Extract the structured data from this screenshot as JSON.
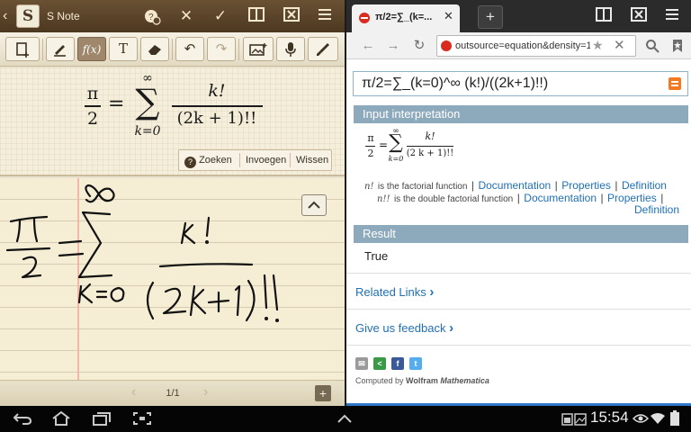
{
  "snote": {
    "app_title": "S Note",
    "icons": {
      "back": "back-arrow-icon",
      "logo": "s-note-logo-icon",
      "top_bar": [
        "recognize-math-icon",
        "close-icon",
        "checkmark-icon",
        "split-view-icon",
        "delete-page-icon",
        "menu-icon"
      ],
      "toolbar": [
        "insert-page-icon",
        "pen-icon",
        "formula-match-icon",
        "text-mode-icon",
        "eraser-icon",
        "undo-icon",
        "redo-icon",
        "insert-image-icon",
        "voice-icon",
        "brush-icon"
      ]
    },
    "formula": {
      "lhs_num": "π",
      "lhs_den": "2",
      "equals": "=",
      "sum_upper": "∞",
      "sum_sign": "∑",
      "sum_lower": "k=0",
      "frac_num": "k!",
      "frac_den": "(2k + 1)!!"
    },
    "convert_buttons": {
      "search": "Zoeken",
      "insert": "Invoegen",
      "clear": "Wissen"
    },
    "handwriting": {
      "text": "π/2 = ∑ k!/(2k+1)!!"
    },
    "pager": {
      "page": "1/1"
    }
  },
  "browser": {
    "tab_title": "π/2=∑_(k=...",
    "tab_close": "✕",
    "new_tab": "+",
    "url": "outsource=equation&density=1",
    "icons": {
      "tab_favicon": "wolfram-favicon-icon",
      "back": "back-icon",
      "forward": "forward-icon",
      "reload": "reload-icon",
      "star": "bookmark-star-icon",
      "clear": "clear-url-icon",
      "search": "search-icon",
      "bookmarks": "bookmarks-icon",
      "tab_overview": "tabs-icon",
      "close_window": "close-window-icon",
      "menu": "menu-icon"
    },
    "wolfram": {
      "input_text": "π/2=∑_(k=0)^∞ (k!)/((2k+1)!!)",
      "input_interpretation_header": "Input interpretation",
      "interp": {
        "lhs_num": "π",
        "lhs_den": "2",
        "equals": "=",
        "sum_upper": "∞",
        "sum_sign": "∑",
        "sum_lower": "k=0",
        "frac_num": "k!",
        "frac_den": "(2 k + 1)!!"
      },
      "notes": [
        {
          "prefix": "n!",
          "text": "is the factorial function",
          "links": [
            "Documentation",
            "Properties",
            "Definition"
          ]
        },
        {
          "prefix": "n!!",
          "text": "is the double factorial function",
          "links": [
            "Documentation",
            "Properties",
            "Definition"
          ]
        }
      ],
      "result_header": "Result",
      "result_value": "True",
      "related_links": "Related Links",
      "feedback": "Give us feedback",
      "computed_by": "Computed by",
      "wolfram": "Wolfram",
      "mathematica": "Mathematica",
      "share_icons": [
        "email-icon",
        "share-icon",
        "facebook-icon",
        "twitter-icon"
      ],
      "separator": "|",
      "chevron": "›"
    }
  },
  "system_bar": {
    "time": "15:54",
    "icons": [
      "back-icon",
      "home-icon",
      "recent-apps-icon",
      "screenshot-icon",
      "up-arrow-icon",
      "notification-icons",
      "eye-icon",
      "wifi-icon",
      "battery-icon"
    ]
  },
  "colors": {
    "snote_title_bg": "#5d462b",
    "pod_header": "#8da9bc",
    "link": "#2070b5",
    "wolfram_orange": "#f47920"
  }
}
